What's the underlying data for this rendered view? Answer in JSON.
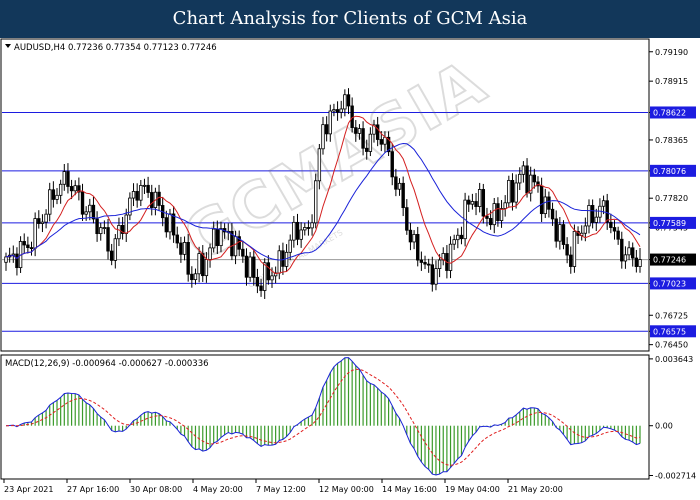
{
  "banner": {
    "title": "Chart Analysis for Clients of GCM Asia"
  },
  "chart_data": [
    {
      "type": "candlestick",
      "header": "AUDUSD,H4  0.77236 0.77354 0.77123 0.77246",
      "symbol": "AUDUSD",
      "timeframe": "H4",
      "ohlc_last": {
        "open": 0.77236,
        "high": 0.77354,
        "low": 0.77123,
        "close": 0.77246
      },
      "ylim": [
        0.764,
        0.793
      ],
      "y_ticks": [
        0.7919,
        0.78915,
        0.78622,
        0.78365,
        0.78076,
        0.7782,
        0.77545,
        0.77589,
        0.77246,
        0.77023,
        0.76725,
        0.76575,
        0.7645
      ],
      "levels": [
        {
          "label": "0.78622",
          "value": 0.78622
        },
        {
          "label": "0.78076",
          "value": 0.78076
        },
        {
          "label": "0.77589",
          "value": 0.77589
        },
        {
          "label": "0.77023",
          "value": 0.77023
        },
        {
          "label": "0.76575",
          "value": 0.76575
        }
      ],
      "current_price": "0.77246",
      "x_ticks": [
        "23 Apr 2021",
        "27 Apr 16:00",
        "30 Apr 08:00",
        "4 May 20:00",
        "7 May 12:00",
        "12 May 00:00",
        "14 May 16:00",
        "19 May 04:00",
        "21 May 20:00"
      ],
      "close_path": [
        [
          0,
          0.7722
        ],
        [
          6,
          0.7738
        ],
        [
          10,
          0.7765
        ],
        [
          14,
          0.7791
        ],
        [
          17,
          0.78
        ],
        [
          21,
          0.7776
        ],
        [
          26,
          0.7753
        ],
        [
          29,
          0.773
        ],
        [
          33,
          0.7768
        ],
        [
          36,
          0.7792
        ],
        [
          40,
          0.7785
        ],
        [
          44,
          0.776
        ],
        [
          47,
          0.7744
        ],
        [
          51,
          0.7709
        ],
        [
          55,
          0.7725
        ],
        [
          58,
          0.7752
        ],
        [
          62,
          0.7743
        ],
        [
          66,
          0.7721
        ],
        [
          69,
          0.7702
        ],
        [
          72,
          0.771
        ],
        [
          75,
          0.7719
        ],
        [
          78,
          0.7742
        ],
        [
          80,
          0.7755
        ],
        [
          83,
          0.7748
        ],
        [
          85,
          0.7795
        ],
        [
          87,
          0.785
        ],
        [
          90,
          0.786
        ],
        [
          92,
          0.7873
        ],
        [
          94,
          0.7866
        ],
        [
          96,
          0.7845
        ],
        [
          98,
          0.783
        ],
        [
          101,
          0.7843
        ],
        [
          103,
          0.784
        ],
        [
          105,
          0.7822
        ],
        [
          107,
          0.7795
        ],
        [
          109,
          0.7775
        ],
        [
          111,
          0.7742
        ],
        [
          114,
          0.7726
        ],
        [
          116,
          0.771
        ],
        [
          118,
          0.7716
        ],
        [
          121,
          0.7728
        ],
        [
          124,
          0.7745
        ],
        [
          126,
          0.777
        ],
        [
          129,
          0.7785
        ],
        [
          131,
          0.7768
        ],
        [
          134,
          0.7762
        ],
        [
          136,
          0.7775
        ],
        [
          139,
          0.779
        ],
        [
          141,
          0.7803
        ],
        [
          144,
          0.78
        ],
        [
          147,
          0.7782
        ],
        [
          150,
          0.7762
        ],
        [
          153,
          0.7738
        ],
        [
          155,
          0.7726
        ],
        [
          157,
          0.775
        ],
        [
          160,
          0.7763
        ],
        [
          163,
          0.7772
        ],
        [
          165,
          0.7769
        ],
        [
          167,
          0.7745
        ],
        [
          170,
          0.7728
        ],
        [
          173,
          0.7727
        ],
        [
          174,
          0.7725
        ]
      ],
      "ma_fast_color": "#d42020",
      "ma_slow_color": "#1a22d8",
      "candle_color": "#000000",
      "level_color": "#1c1ce0"
    },
    {
      "type": "macd",
      "header": "MACD(12,26,9)  -0.000964 -0.000627 -0.000336",
      "params": "12,26,9",
      "values": {
        "macd": -0.000964,
        "signal": -0.000627,
        "histogram": -0.000336
      },
      "ylim": [
        -0.00285,
        0.0038
      ],
      "y_ticks": [
        "0.003643",
        "0.00",
        "-0.002714"
      ],
      "macd_color": "#1a22d8",
      "signal_color": "#e02020",
      "histogram_color": "#3a9a2a"
    }
  ],
  "watermark": {
    "text": "GCMASIA",
    "sub": "GLOBAL CAPITAL MARKETS"
  }
}
